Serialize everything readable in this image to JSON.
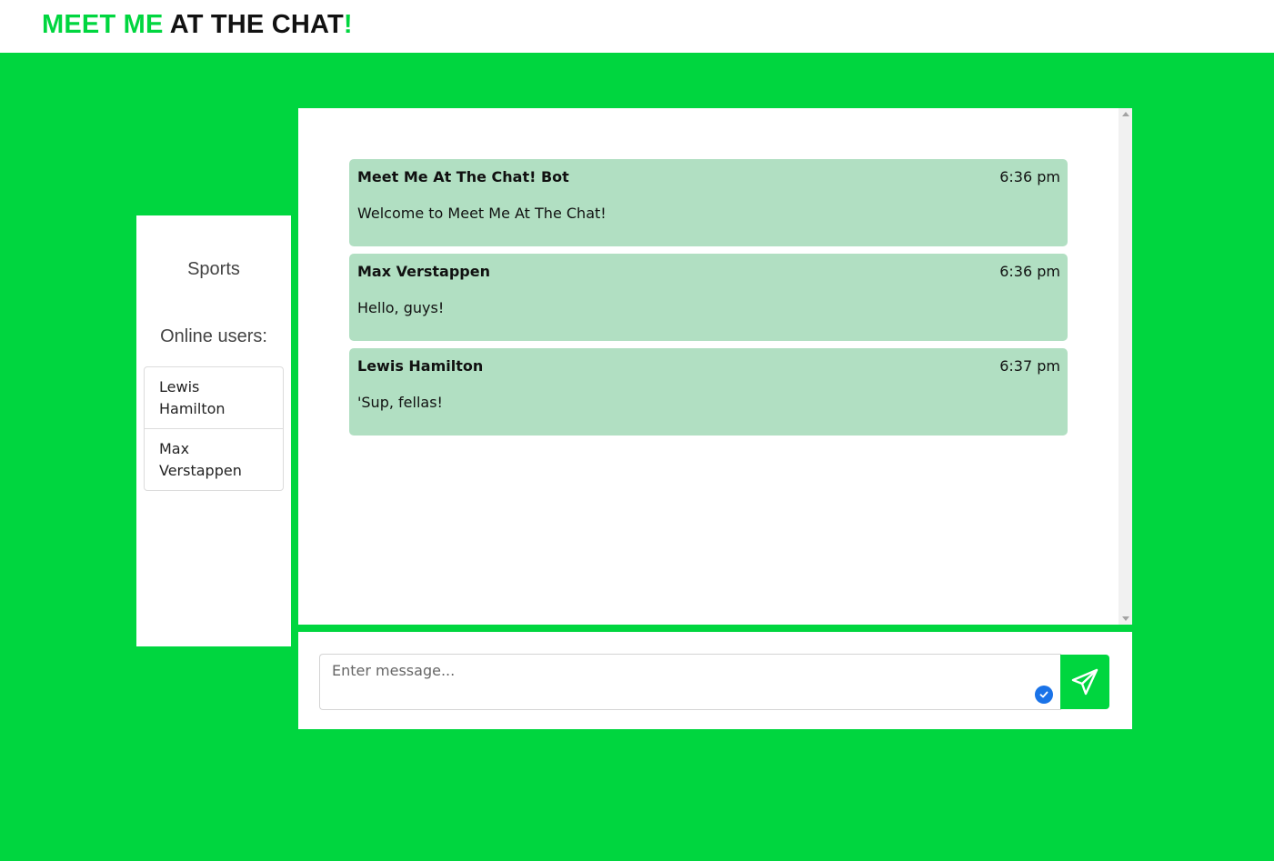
{
  "brand": {
    "part1": "MEET ME",
    "part2": "AT THE CHAT",
    "part3": "!"
  },
  "sidebar": {
    "room_name": "Sports",
    "online_label": "Online users:",
    "users": [
      "Lewis Hamilton",
      "Max Verstappen"
    ]
  },
  "messages": [
    {
      "author": "Meet Me At The Chat! Bot",
      "time": "6:36 pm",
      "text": "Welcome to Meet Me At The Chat!"
    },
    {
      "author": "Max Verstappen",
      "time": "6:36 pm",
      "text": "Hello, guys!"
    },
    {
      "author": "Lewis Hamilton",
      "time": "6:37 pm",
      "text": "'Sup, fellas!"
    }
  ],
  "composer": {
    "placeholder": "Enter message...",
    "send_icon": "paper-plane-icon"
  },
  "colors": {
    "accent": "#00d63f",
    "message_bg": "#b1dfc2",
    "text": "#111111"
  }
}
